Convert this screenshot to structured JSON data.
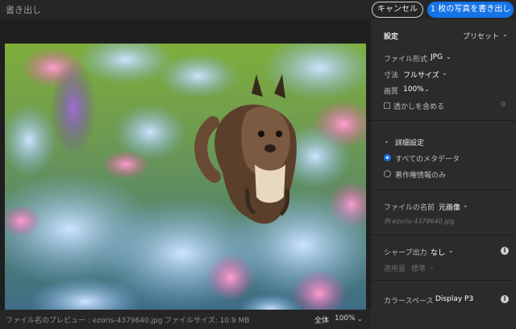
{
  "window": {
    "title": "書き出し"
  },
  "header": {
    "cancel_label": "キャンセル",
    "export_label": "1 枚の写真を書き出し"
  },
  "footer": {
    "filename_preview": "ファイル名のプレビュー : ezoris-4379640.jpg",
    "filesize": "ファイルサイズ: 10.9 MB",
    "view_mode": "全体",
    "zoom": "100%"
  },
  "settings": {
    "title": "設定",
    "preset_label": "プリセット",
    "file_format_label": "ファイル形式",
    "file_format_value": "JPG",
    "size_label": "寸法",
    "size_value": "フルサイズ",
    "quality_label": "画質",
    "quality_value": "100%",
    "watermark_label": "透かしを含める"
  },
  "advanced": {
    "title": "詳細設定",
    "option_all_meta": "すべてのメタデータ",
    "option_copyright": "著作権情報のみ"
  },
  "filename": {
    "label": "ファイルの名前",
    "value": "元画像",
    "example": "例  ezoris-4379640.jpg"
  },
  "sharpen": {
    "label": "シャープ出力",
    "value": "なし",
    "amount_label": "適用量",
    "amount_value": "標準"
  },
  "colorspace": {
    "label": "カラースペース",
    "value": "Display P3"
  },
  "icons": {
    "chevron": "chevron-down-icon",
    "info": "info-icon",
    "gear": "gear-icon"
  },
  "colors": {
    "accent": "#1473e6",
    "panel": "#2b2b2b",
    "background": "#1f1f1f"
  }
}
